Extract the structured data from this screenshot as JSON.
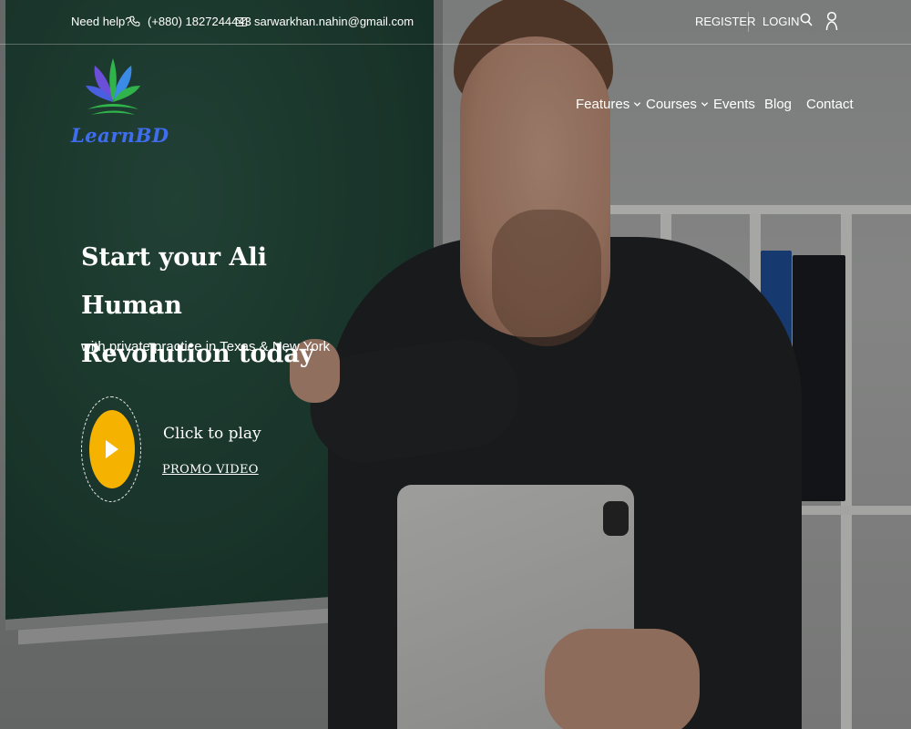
{
  "topbar": {
    "help_label": "Need help?",
    "phone": "(+880) 1827244443",
    "email": "sarwarkhan.nahin@gmail.com",
    "register_label": "REGISTER",
    "login_label": "LOGIN"
  },
  "brand": {
    "logo_text": "LearnBD",
    "logo_colors": {
      "leaf_green": "#2fb34a",
      "leaf_purple": "#6b4fd8",
      "leaf_blue": "#3b8be6",
      "text_blue": "#3f6df0"
    }
  },
  "nav": {
    "items": [
      {
        "label": "Features",
        "has_dropdown": true
      },
      {
        "label": "Courses",
        "has_dropdown": true
      },
      {
        "label": "Events",
        "has_dropdown": false
      },
      {
        "label": "Blog",
        "has_dropdown": false
      },
      {
        "label": "Contact",
        "has_dropdown": false
      }
    ]
  },
  "hero": {
    "title_line1": "Start your Ali Human",
    "title_line2": "Revolution today",
    "subtitle": "with private practice in Texas & New York",
    "play_caption": "Click to play",
    "promo_label": "PROMO VIDEO",
    "play_button_color": "#f5b300"
  },
  "icons": {
    "phone": "phone-icon",
    "email": "envelope-icon",
    "search": "search-icon",
    "user": "user-icon",
    "play": "play-icon",
    "dropdown": "chevron-down-icon"
  }
}
